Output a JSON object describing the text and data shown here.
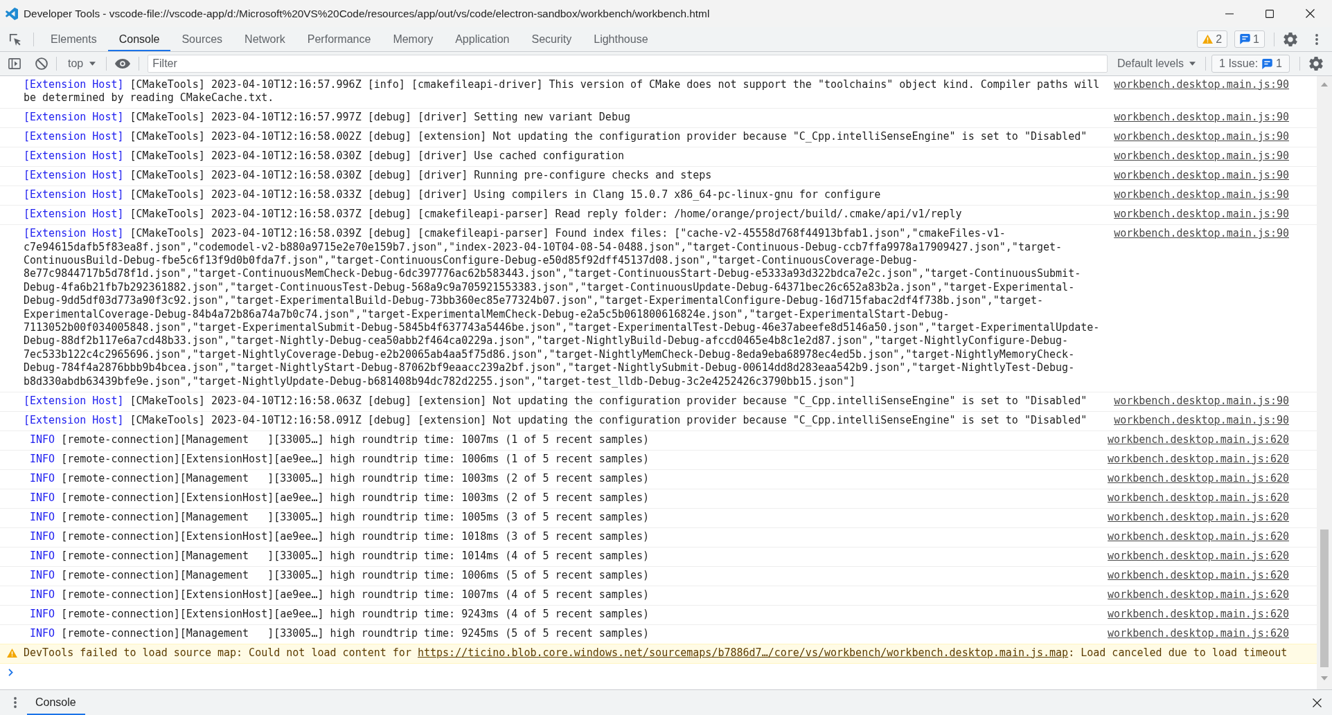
{
  "window": {
    "title": "Developer Tools - vscode-file://vscode-app/d:/Microsoft%20VS%20Code/resources/app/out/vs/code/electron-sandbox/workbench/workbench.html"
  },
  "tabs": [
    {
      "label": "Elements",
      "selected": false
    },
    {
      "label": "Console",
      "selected": true
    },
    {
      "label": "Sources",
      "selected": false
    },
    {
      "label": "Network",
      "selected": false
    },
    {
      "label": "Performance",
      "selected": false
    },
    {
      "label": "Memory",
      "selected": false
    },
    {
      "label": "Application",
      "selected": false
    },
    {
      "label": "Security",
      "selected": false
    },
    {
      "label": "Lighthouse",
      "selected": false
    }
  ],
  "counters": {
    "warnings": "2",
    "messages": "1"
  },
  "toolbar": {
    "context": "top",
    "filter": {
      "placeholder": "Filter"
    },
    "levels": "Default levels",
    "issues": {
      "label": "1 Issue:",
      "count": "1"
    }
  },
  "messages": [
    {
      "kind": "log",
      "prefix": "[Extension Host]",
      "text": "[CMakeTools] 2023-04-10T12:16:57.996Z [info] [cmakefileapi-driver] This version of CMake does not support the \"toolchains\" object kind. Compiler paths will be determined by reading CMakeCache.txt.",
      "source": "workbench.desktop.main.js:90"
    },
    {
      "kind": "log",
      "prefix": "[Extension Host]",
      "text": "[CMakeTools] 2023-04-10T12:16:57.997Z [debug] [driver] Setting new variant Debug",
      "source": "workbench.desktop.main.js:90"
    },
    {
      "kind": "log",
      "prefix": "[Extension Host]",
      "text": "[CMakeTools] 2023-04-10T12:16:58.002Z [debug] [extension] Not updating the configuration provider because \"C_Cpp.intelliSenseEngine\" is set to \"Disabled\"",
      "source": "workbench.desktop.main.js:90"
    },
    {
      "kind": "log",
      "prefix": "[Extension Host]",
      "text": "[CMakeTools] 2023-04-10T12:16:58.030Z [debug] [driver] Use cached configuration",
      "source": "workbench.desktop.main.js:90"
    },
    {
      "kind": "log",
      "prefix": "[Extension Host]",
      "text": "[CMakeTools] 2023-04-10T12:16:58.030Z [debug] [driver] Running pre-configure checks and steps",
      "source": "workbench.desktop.main.js:90"
    },
    {
      "kind": "log",
      "prefix": "[Extension Host]",
      "text": "[CMakeTools] 2023-04-10T12:16:58.033Z [debug] [driver] Using compilers in Clang 15.0.7 x86_64-pc-linux-gnu for configure",
      "source": "workbench.desktop.main.js:90"
    },
    {
      "kind": "log",
      "prefix": "[Extension Host]",
      "text": "[CMakeTools] 2023-04-10T12:16:58.037Z [debug] [cmakefileapi-parser] Read reply folder: /home/orange/project/build/.cmake/api/v1/reply",
      "source": "workbench.desktop.main.js:90"
    },
    {
      "kind": "log",
      "prefix": "[Extension Host]",
      "text": "[CMakeTools] 2023-04-10T12:16:58.039Z [debug] [cmakefileapi-parser] Found index files: [\"cache-v2-45558d768f44913bfab1.json\",\"cmakeFiles-v1-c7e94615dafb5f83ea8f.json\",\"codemodel-v2-b880a9715e2e70e159b7.json\",\"index-2023-04-10T04-08-54-0488.json\",\"target-Continuous-Debug-ccb7ffa9978a17909427.json\",\"target-ContinuousBuild-Debug-fbe5c6f13f9d0b0fda7f.json\",\"target-ContinuousConfigure-Debug-e50d85f92dff45137d08.json\",\"target-ContinuousCoverage-Debug-8e77c9844717b5d78f1d.json\",\"target-ContinuousMemCheck-Debug-6dc397776ac62b583443.json\",\"target-ContinuousStart-Debug-e5333a93d322bdca7e2c.json\",\"target-ContinuousSubmit-Debug-4fa6b21fb7b292361882.json\",\"target-ContinuousTest-Debug-568a9c9a705921553383.json\",\"target-ContinuousUpdate-Debug-64371bec26c652a83b2a.json\",\"target-Experimental-Debug-9dd5df03d773a90f3c92.json\",\"target-ExperimentalBuild-Debug-73bb360ec85e77324b07.json\",\"target-ExperimentalConfigure-Debug-16d715fabac2df4f738b.json\",\"target-ExperimentalCoverage-Debug-84b4a72b86a74a7b0c74.json\",\"target-ExperimentalMemCheck-Debug-e2a5c5b061800616824e.json\",\"target-ExperimentalStart-Debug-7113052b00f034005848.json\",\"target-ExperimentalSubmit-Debug-5845b4f637743a5446be.json\",\"target-ExperimentalTest-Debug-46e37abeefe8d5146a50.json\",\"target-ExperimentalUpdate-Debug-88df2b117e6a7cd48b33.json\",\"target-Nightly-Debug-cea50abb2f464ca0229a.json\",\"target-NightlyBuild-Debug-afccd0465e4b8c1e2d87.json\",\"target-NightlyConfigure-Debug-7ec533b122c4c2965696.json\",\"target-NightlyCoverage-Debug-e2b20065ab4aa5f75d86.json\",\"target-NightlyMemCheck-Debug-8eda9eba68978ec4ed5b.json\",\"target-NightlyMemoryCheck-Debug-784f4a2876bbb9b4bcea.json\",\"target-NightlyStart-Debug-87062bf9eaacc239a2bf.json\",\"target-NightlySubmit-Debug-00614dd8d283eaa542b9.json\",\"target-NightlyTest-Debug-b8d330abdb63439bfe9e.json\",\"target-NightlyUpdate-Debug-b681408b94dc782d2255.json\",\"target-test_lldb-Debug-3c2e4252426c3790bb15.json\"]",
      "source": "workbench.desktop.main.js:90"
    },
    {
      "kind": "log",
      "prefix": "[Extension Host]",
      "text": "[CMakeTools] 2023-04-10T12:16:58.063Z [debug] [extension] Not updating the configuration provider because \"C_Cpp.intelliSenseEngine\" is set to \"Disabled\"",
      "source": "workbench.desktop.main.js:90"
    },
    {
      "kind": "log",
      "prefix": "[Extension Host]",
      "text": "[CMakeTools] 2023-04-10T12:16:58.091Z [debug] [extension] Not updating the configuration provider because \"C_Cpp.intelliSenseEngine\" is set to \"Disabled\"",
      "source": "workbench.desktop.main.js:90"
    },
    {
      "kind": "info",
      "tag": "INFO",
      "text": "[remote-connection][Management   ][33005…] high roundtrip time: 1007ms (1 of 5 recent samples)",
      "source": "workbench.desktop.main.js:620"
    },
    {
      "kind": "info",
      "tag": "INFO",
      "text": "[remote-connection][ExtensionHost][ae9ee…] high roundtrip time: 1006ms (1 of 5 recent samples)",
      "source": "workbench.desktop.main.js:620"
    },
    {
      "kind": "info",
      "tag": "INFO",
      "text": "[remote-connection][Management   ][33005…] high roundtrip time: 1003ms (2 of 5 recent samples)",
      "source": "workbench.desktop.main.js:620"
    },
    {
      "kind": "info",
      "tag": "INFO",
      "text": "[remote-connection][ExtensionHost][ae9ee…] high roundtrip time: 1003ms (2 of 5 recent samples)",
      "source": "workbench.desktop.main.js:620"
    },
    {
      "kind": "info",
      "tag": "INFO",
      "text": "[remote-connection][Management   ][33005…] high roundtrip time: 1005ms (3 of 5 recent samples)",
      "source": "workbench.desktop.main.js:620"
    },
    {
      "kind": "info",
      "tag": "INFO",
      "text": "[remote-connection][ExtensionHost][ae9ee…] high roundtrip time: 1018ms (3 of 5 recent samples)",
      "source": "workbench.desktop.main.js:620"
    },
    {
      "kind": "info",
      "tag": "INFO",
      "text": "[remote-connection][Management   ][33005…] high roundtrip time: 1014ms (4 of 5 recent samples)",
      "source": "workbench.desktop.main.js:620"
    },
    {
      "kind": "info",
      "tag": "INFO",
      "text": "[remote-connection][Management   ][33005…] high roundtrip time: 1006ms (5 of 5 recent samples)",
      "source": "workbench.desktop.main.js:620"
    },
    {
      "kind": "info",
      "tag": "INFO",
      "text": "[remote-connection][ExtensionHost][ae9ee…] high roundtrip time: 1007ms (4 of 5 recent samples)",
      "source": "workbench.desktop.main.js:620"
    },
    {
      "kind": "info",
      "tag": "INFO",
      "text": "[remote-connection][ExtensionHost][ae9ee…] high roundtrip time: 9243ms (4 of 5 recent samples)",
      "source": "workbench.desktop.main.js:620"
    },
    {
      "kind": "info",
      "tag": "INFO",
      "text": "[remote-connection][Management   ][33005…] high roundtrip time: 9245ms (5 of 5 recent samples)",
      "source": "workbench.desktop.main.js:620"
    },
    {
      "kind": "warning",
      "text": "DevTools failed to load source map: Could not load content for ",
      "link": "https://ticino.blob.core.windows.net/sourcemaps/b7886d7…/core/vs/workbench/workbench.desktop.main.js.map",
      "text_after": ": Load canceled due to load timeout"
    }
  ],
  "drawer": {
    "tabs": [
      {
        "label": "Console",
        "selected": true
      }
    ]
  }
}
